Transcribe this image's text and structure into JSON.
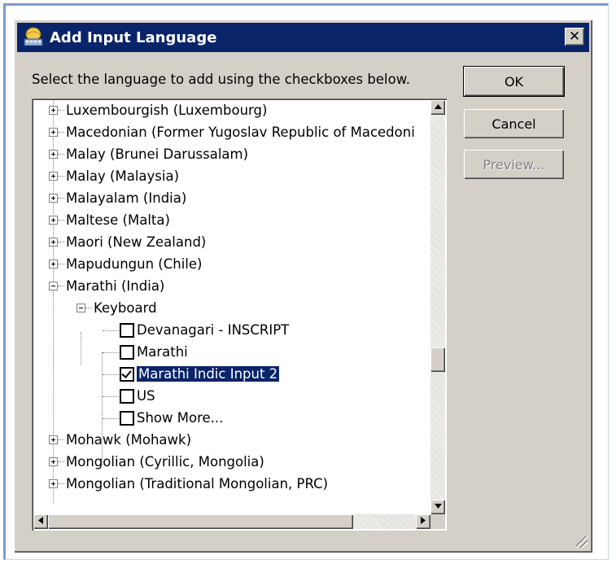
{
  "dialog": {
    "title": "Add Input Language",
    "close_symbol": "✕",
    "instruction": "Select the language to add using the checkboxes below.",
    "buttons": {
      "ok": "OK",
      "cancel": "Cancel",
      "preview": "Preview..."
    }
  },
  "tree": {
    "languages_before": [
      "Luxembourgish (Luxembourg)",
      "Macedonian (Former Yugoslav Republic of Macedoni",
      "Malay (Brunei Darussalam)",
      "Malay (Malaysia)",
      "Malayalam (India)",
      "Maltese (Malta)",
      "Maori (New Zealand)",
      "Mapudungun (Chile)"
    ],
    "expanded_language": "Marathi (India)",
    "keyboard_group": "Keyboard",
    "keyboards": [
      {
        "label": "Devanagari - INSCRIPT",
        "checked": false
      },
      {
        "label": "Marathi",
        "checked": false
      },
      {
        "label": "Marathi Indic Input 2",
        "checked": true,
        "selected": true
      },
      {
        "label": "US",
        "checked": false
      },
      {
        "label": "Show More...",
        "checked": false
      }
    ],
    "languages_after": [
      "Mohawk (Mohawk)",
      "Mongolian (Cyrillic, Mongolia)",
      "Mongolian (Traditional Mongolian, PRC)"
    ]
  },
  "colors": {
    "titlebar": "#0a246a",
    "face": "#d4d0c8",
    "selection": "#0a246a"
  }
}
